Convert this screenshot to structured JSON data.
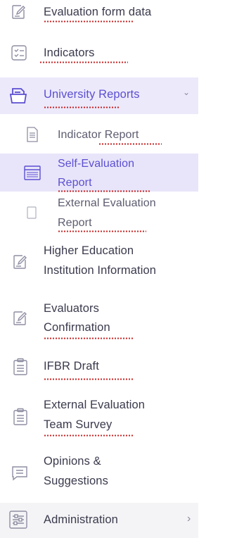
{
  "menu": {
    "items": [
      {
        "label": "Evaluation form data"
      },
      {
        "label": "Indicators"
      },
      {
        "label": "University Reports"
      },
      {
        "label": "Indicator Report"
      },
      {
        "label_line1": "Self-Evaluation",
        "label_line2": "Report"
      },
      {
        "label_line1": "External Evaluation",
        "label_line2": "Report"
      },
      {
        "label_line1": "Higher Education",
        "label_line2": "Institution Information"
      },
      {
        "label_line1": "Evaluators",
        "label_line2": "Confirmation"
      },
      {
        "label": "IFBR Draft"
      },
      {
        "label_line1": "External Evaluation",
        "label_line2": "Team Survey"
      },
      {
        "label_line1": "Opinions &",
        "label_line2": "Suggestions"
      },
      {
        "label": "Administration"
      }
    ],
    "chevron_down": "⌄",
    "chevron_right": "›"
  },
  "colors": {
    "accent": "#5b4fd1",
    "active_bg": "#ece9fb",
    "spell_underline": "#c32222"
  }
}
